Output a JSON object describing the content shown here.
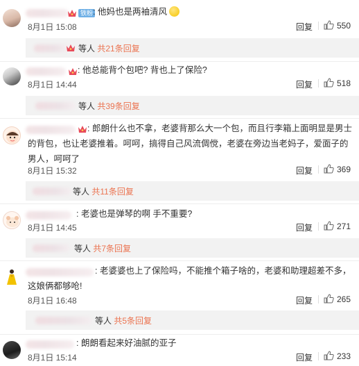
{
  "comments": [
    {
      "text": "他妈也是两袖清风",
      "emoji": "smile-emoji",
      "badge": "铁粉",
      "time": "8月1日 15:08",
      "reply_label": "回复",
      "likes": "550",
      "reply_bar": {
        "suffix": "等人",
        "total": "共21条回复"
      }
    },
    {
      "text": "他总能背个包吧? 背也上了保险?",
      "time": "8月1日 14:44",
      "reply_label": "回复",
      "likes": "518",
      "reply_bar": {
        "suffix": "等人",
        "total": "共39条回复"
      }
    },
    {
      "text": "郎朗什么也不拿，老婆背那么大一个包，而且行李箱上面明显是男士的背包，也让老婆推着。呵呵，搞得自己风流倜傥，老婆在旁边当老妈子，爱面子的男人，呵呵了",
      "time": "8月1日 15:32",
      "reply_label": "回复",
      "likes": "369",
      "reply_bar": {
        "suffix": "等人",
        "total": "共11条回复"
      }
    },
    {
      "text": "老婆也是弹琴的啊 手不重要?",
      "time": "8月1日 14:45",
      "reply_label": "回复",
      "likes": "271",
      "reply_bar": {
        "suffix": "等人",
        "total": "共7条回复"
      }
    },
    {
      "text": "老婆婆也上了保险吗，不能推个箱子啥的，老婆和助理超差不多，这娘俩都够呛!",
      "time": "8月1日 16:48",
      "reply_label": "回复",
      "likes": "265",
      "reply_bar": {
        "suffix": "等人",
        "total": "共5条回复"
      }
    },
    {
      "text": "朗朗看起来好油腻的亚子",
      "time": "8月1日 15:14",
      "reply_label": "回复",
      "likes": "233"
    }
  ],
  "colors": {
    "accent": "#eb7350",
    "reply_bar_bg": "#f2f2f2",
    "badge": "#6fb0e6"
  },
  "icons": [
    "thumbs-up-icon",
    "crown-icon",
    "smile-emoji"
  ]
}
